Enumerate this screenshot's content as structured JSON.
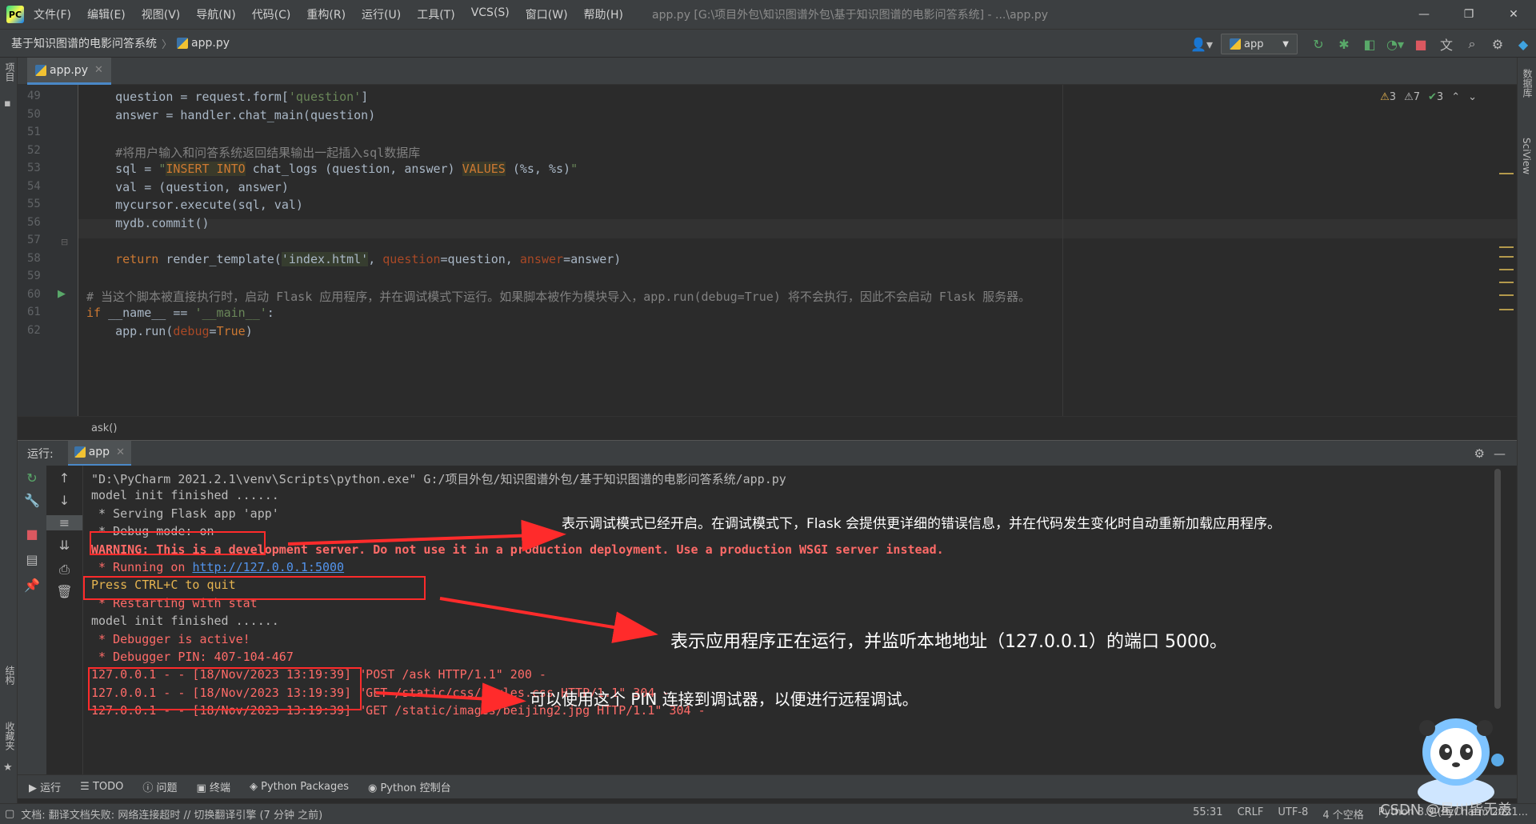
{
  "titlebar": {
    "menu": [
      "文件(F)",
      "编辑(E)",
      "视图(V)",
      "导航(N)",
      "代码(C)",
      "重构(R)",
      "运行(U)",
      "工具(T)",
      "VCS(S)",
      "窗口(W)",
      "帮助(H)"
    ],
    "window_title": "app.py [G:\\项目外包\\知识图谱外包\\基于知识图谱的电影问答系统] - ...\\app.py"
  },
  "navbar": {
    "project": "基于知识图谱的电影问答系统",
    "file": "app.py",
    "run_config": "app"
  },
  "left_strip": {
    "top_label": "项目",
    "mid_label": "结构",
    "bottom_label": "收藏夹"
  },
  "right_strip": {
    "top_label": "数据库",
    "mid_label": "SciView"
  },
  "editor": {
    "tab": "app.py",
    "inspection": {
      "warnings_a": "3",
      "warnings_b": "7",
      "ok": "3"
    },
    "lines": [
      {
        "n": "49",
        "code": [
          [
            "",
            "    question = request.form["
          ],
          [
            "str",
            "'question'"
          ],
          [
            "",
            "]"
          ]
        ]
      },
      {
        "n": "50",
        "code": [
          [
            "",
            "    answer = handler.chat_main(question)"
          ]
        ]
      },
      {
        "n": "51",
        "code": [
          [
            "",
            ""
          ]
        ]
      },
      {
        "n": "52",
        "code": [
          [
            "cmt",
            "    #将用户输入和问答系统返回结果输出一起插入sql数据库"
          ]
        ]
      },
      {
        "n": "53",
        "code": [
          [
            "",
            "    sql = "
          ],
          [
            "str",
            "\""
          ],
          [
            "sqlbg",
            "INSERT INTO"
          ],
          [
            "",
            " chat_logs (question, answer) "
          ],
          [
            "sqlbg",
            "VALUES"
          ],
          [
            "",
            " (%s, %s)"
          ],
          [
            "str",
            "\""
          ]
        ]
      },
      {
        "n": "54",
        "code": [
          [
            "",
            "    val = (question, answer)"
          ]
        ]
      },
      {
        "n": "55",
        "code": [
          [
            "",
            "    mycursor.execute(sql, val)"
          ]
        ]
      },
      {
        "n": "56",
        "code": [
          [
            "",
            "    mydb.commit()"
          ]
        ]
      },
      {
        "n": "57",
        "code": [
          [
            "",
            ""
          ]
        ]
      },
      {
        "n": "58",
        "code": [
          [
            "",
            "    "
          ],
          [
            "kw",
            "return"
          ],
          [
            "",
            " render_template("
          ],
          [
            "strbg",
            "'index.html'"
          ],
          [
            "",
            ", "
          ],
          [
            "param",
            "question"
          ],
          [
            "",
            "=question, "
          ],
          [
            "param",
            "answer"
          ],
          [
            "",
            "=answer)"
          ]
        ]
      },
      {
        "n": "59",
        "code": [
          [
            "",
            ""
          ]
        ]
      },
      {
        "n": "60",
        "code": [
          [
            "cmt",
            "# 当这个脚本被直接执行时，启动 Flask 应用程序，并在调试模式下运行。如果脚本被作为模块导入，app.run(debug=True) 将不会执行，因此不会启动 Flask 服务器。"
          ]
        ]
      },
      {
        "n": "61",
        "code": [
          [
            "kw",
            "if"
          ],
          [
            "",
            " __name__ == "
          ],
          [
            "str",
            "'__main__'"
          ],
          [
            "",
            ":"
          ]
        ]
      },
      {
        "n": "62",
        "code": [
          [
            "",
            "    app.run("
          ],
          [
            "param",
            "debug"
          ],
          [
            "",
            "="
          ],
          [
            "kw",
            "True"
          ],
          [
            "",
            ")"
          ]
        ]
      }
    ],
    "breadcrumb": "ask()"
  },
  "run": {
    "label": "运行:",
    "tab": "app",
    "console": [
      {
        "cls": "",
        "text": "\"D:\\PyCharm 2021.2.1\\venv\\Scripts\\python.exe\" G:/项目外包/知识图谱外包/基于知识图谱的电影问答系统/app.py"
      },
      {
        "cls": "",
        "text": "model init finished ......"
      },
      {
        "cls": "",
        "text": " * Serving Flask app 'app'"
      },
      {
        "cls": "",
        "text": " * Debug mode: on"
      },
      {
        "cls": "warn",
        "text": "WARNING: This is a development server. Do not use it in a production deployment. Use a production WSGI server instead."
      },
      {
        "cls": "red",
        "text": " * Running on ",
        "link": "http://127.0.0.1:5000"
      },
      {
        "cls": "",
        "text": "Press CTRL+C to quit",
        "color": "#e6b450"
      },
      {
        "cls": "red",
        "text": " * Restarting with stat"
      },
      {
        "cls": "",
        "text": "model init finished ......"
      },
      {
        "cls": "red",
        "text": " * Debugger is active!"
      },
      {
        "cls": "red",
        "text": " * Debugger PIN: 407-104-467"
      },
      {
        "cls": "red",
        "text": "127.0.0.1 - - [18/Nov/2023 13:19:39] \"POST /ask HTTP/1.1\" 200 -"
      },
      {
        "cls": "red",
        "text": "127.0.0.1 - - [18/Nov/2023 13:19:39] \"GET /static/css/styles.css HTTP/1.1\" 304 -"
      },
      {
        "cls": "red",
        "text": "127.0.0.1 - - [18/Nov/2023 13:19:39] \"GET /static/images/beijing2.jpg HTTP/1.1\" 304 -"
      }
    ],
    "annotations": {
      "debug": "表示调试模式已经开启。在调试模式下，Flask 会提供更详细的错误信息，并在代码发生变化时自动重新加载应用程序。",
      "running": "表示应用程序正在运行，并监听本地地址（127.0.0.1）的端口 5000。",
      "pin": "可以使用这个 PIN 连接到调试器，以便进行远程调试。"
    }
  },
  "bottom_tabs": [
    "运行",
    "TODO",
    "问题",
    "终端",
    "Python Packages",
    "Python 控制台"
  ],
  "status": {
    "left": "文档: 翻译文档失败: 网络连接超时 // 切换翻译引擎 (7 分钟 之前)",
    "position": "55:31",
    "line_sep": "CRLF",
    "encoding": "UTF-8",
    "indent": "4 个空格",
    "interpreter": "Python 3.9 (PyCharm 2021..."
  },
  "watermark": "CSDN @星川皆无恙",
  "colors": {
    "accent": "#4a88c7",
    "annotation_box": "#ff2b2b",
    "console_red": "#ff6b68"
  }
}
